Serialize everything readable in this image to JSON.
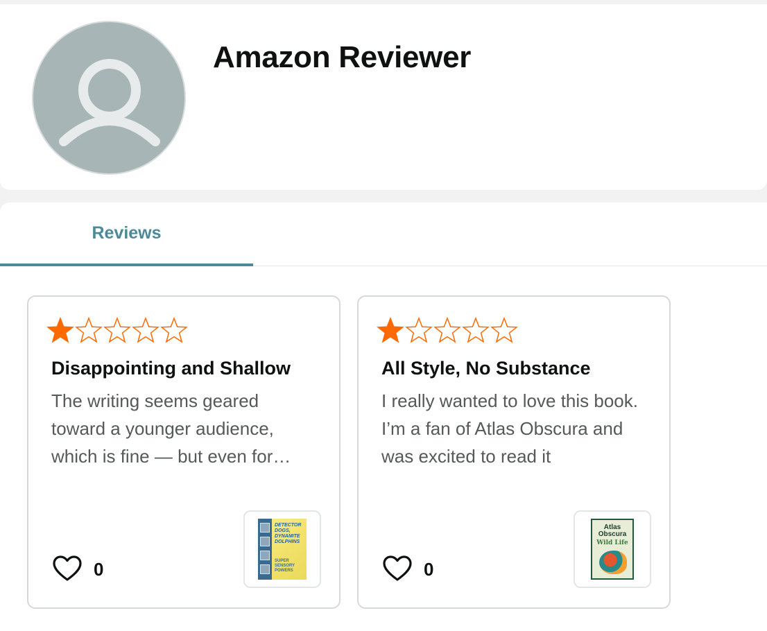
{
  "profile": {
    "name": "Amazon Reviewer"
  },
  "tabs": [
    {
      "label": "Reviews",
      "active": true
    }
  ],
  "colors": {
    "accent": "#4c8a9a",
    "star": "#ff6a00",
    "avatar_bg": "#a7b5b7"
  },
  "reviews": [
    {
      "rating": 1,
      "max_rating": 5,
      "title": "Disappointing and Shallow",
      "body": "The writing seems geared toward a younger audience, which is fine — but even for younger readers",
      "likes": "0",
      "product_thumb_icon": "book-cover-thumbnail"
    },
    {
      "rating": 1,
      "max_rating": 5,
      "title": "All Style, No Substance",
      "body": "I really wanted to love this book. I’m a fan of Atlas Obscura and was excited to read it",
      "likes": "0",
      "product_thumb_icon": "book-cover-thumbnail"
    }
  ]
}
